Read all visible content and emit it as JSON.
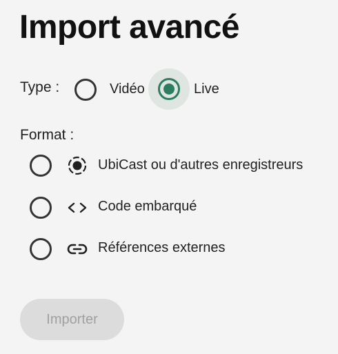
{
  "title": "Import avancé",
  "type_section": {
    "label": "Type :",
    "options": [
      {
        "label": "Vidéo",
        "selected": false
      },
      {
        "label": "Live",
        "selected": true
      }
    ]
  },
  "format_section": {
    "label": "Format :",
    "options": [
      {
        "label": "UbiCast ou d'autres enregistreurs",
        "icon": "record-icon",
        "selected": false
      },
      {
        "label": "Code embarqué",
        "icon": "code-icon",
        "selected": false
      },
      {
        "label": "Références externes",
        "icon": "link-icon",
        "selected": false
      }
    ]
  },
  "import_button": {
    "label": "Importer",
    "disabled": true
  },
  "colors": {
    "accent": "#2e7d60",
    "background": "#f4f4f4",
    "button_disabled_bg": "#dcdcdc",
    "button_disabled_text": "#a0a0a0"
  }
}
